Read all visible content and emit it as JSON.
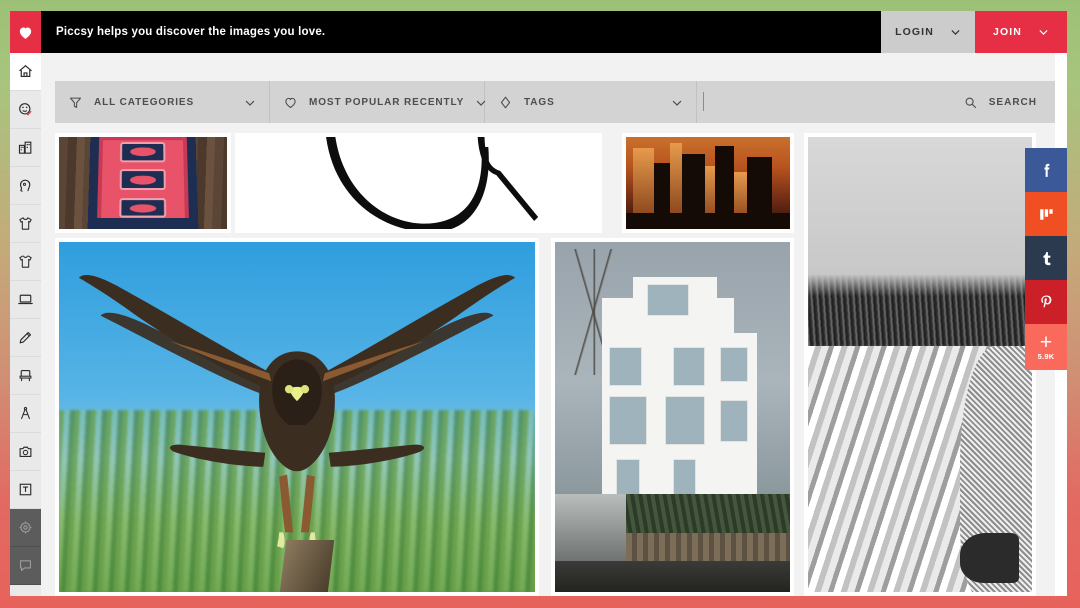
{
  "site": {
    "name": "Piccsy",
    "promo_text": "Piccsy helps you discover the images you love.",
    "logo_icon": "heart-icon",
    "brand_red": "#e62e44",
    "frame_gradient_top": "#9cc176",
    "frame_gradient_bottom": "#e8625c"
  },
  "topbar": {
    "login_label": "LOGIN",
    "login_chevron_icon": "chevron-down-icon",
    "join_label": "JOIN",
    "join_chevron_icon": "chevron-down-icon"
  },
  "sidebar": {
    "items": [
      {
        "name": "home",
        "icon": "home-icon",
        "active": true
      },
      {
        "name": "faces",
        "icon": "face-check-icon",
        "active": false
      },
      {
        "name": "architecture",
        "icon": "buildings-icon",
        "active": false
      },
      {
        "name": "portrait",
        "icon": "head-profile-icon",
        "active": false
      },
      {
        "name": "mens-fashion",
        "icon": "tshirt-icon",
        "active": false
      },
      {
        "name": "womens-fashion",
        "icon": "tshirt-outline-icon",
        "active": false
      },
      {
        "name": "technology",
        "icon": "laptop-icon",
        "active": false
      },
      {
        "name": "art",
        "icon": "pencil-icon",
        "active": false
      },
      {
        "name": "furniture",
        "icon": "chair-icon",
        "active": false
      },
      {
        "name": "design",
        "icon": "compass-icon",
        "active": false
      },
      {
        "name": "photography",
        "icon": "camera-icon",
        "active": false
      },
      {
        "name": "typography",
        "icon": "letter-t-icon",
        "active": false
      },
      {
        "name": "settings",
        "icon": "gear-icon",
        "active": false,
        "dark": true
      },
      {
        "name": "feedback",
        "icon": "chat-bubble-icon",
        "active": false,
        "dark": true
      }
    ]
  },
  "filterbar": {
    "categories": {
      "label": "ALL CATEGORIES",
      "icon": "funnel-icon",
      "chevron": "chevron-down-icon"
    },
    "sort": {
      "label": "MOST POPULAR RECENTLY",
      "icon": "heart-outline-icon",
      "chevron": "chevron-down-icon"
    },
    "tags": {
      "label": "TAGS",
      "icon": "tag-icon",
      "chevron": "chevron-down-icon"
    },
    "search": {
      "label": "SEARCH",
      "icon": "search-icon",
      "value": "",
      "placeholder": ""
    }
  },
  "grid": {
    "items": [
      {
        "id": "rug",
        "alt": "Persian rug runner on dark wood floor"
      },
      {
        "id": "type",
        "alt": "Black calligraphic letterform stroke on white"
      },
      {
        "id": "city",
        "alt": "City skyscrapers silhouetted at orange sunset"
      },
      {
        "id": "beach",
        "alt": "Black and white sand dune with beach grass and seated person"
      },
      {
        "id": "hawk",
        "alt": "Harris hawk in flight over green grass against blue sky"
      },
      {
        "id": "house",
        "alt": "Modern white multi-storey house with hedges and driveway"
      }
    ]
  },
  "social": {
    "buttons": [
      {
        "network": "facebook",
        "icon": "facebook-icon",
        "color": "#3b5998"
      },
      {
        "network": "mix",
        "icon": "mix-icon",
        "color": "#f04e23"
      },
      {
        "network": "tumblr",
        "icon": "tumblr-icon",
        "color": "#2c3a4f"
      },
      {
        "network": "pinterest",
        "icon": "pinterest-icon",
        "color": "#cb2027"
      }
    ],
    "share_more_icon": "plus-icon",
    "share_count": "5.9K"
  }
}
